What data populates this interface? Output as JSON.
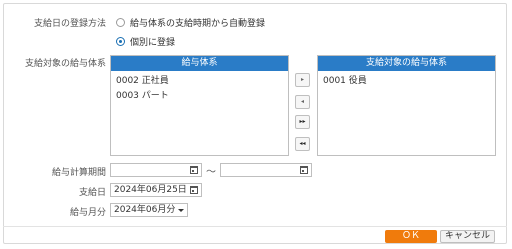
{
  "labels": {
    "registration_method": "支給日の登録方法",
    "target_salary_system": "支給対象の給与体系",
    "calc_period": "給与計算期間",
    "payment_date": "支給日",
    "salary_month": "給与月分"
  },
  "registration_options": [
    {
      "label": "給与体系の支給時期から自動登録",
      "checked": false
    },
    {
      "label": "個別に登録",
      "checked": true
    }
  ],
  "available_list": {
    "header": "給与体系",
    "items": [
      "0002 正社員",
      "0003 パート"
    ]
  },
  "selected_list": {
    "header": "支給対象の給与体系",
    "items": [
      "0001 役員"
    ]
  },
  "move_buttons": {
    "add": "▸",
    "remove": "◂",
    "add_all": "▸▸",
    "remove_all": "◂◂"
  },
  "calc_period": {
    "from": "",
    "to": "",
    "separator": "〜"
  },
  "payment_date_value": "2024年06月25日",
  "salary_month_value": "2024年06月分",
  "buttons": {
    "ok": "ＯＫ",
    "cancel": "キャンセル"
  },
  "colors": {
    "list_header": "#2a7cc7",
    "ok_button": "#f07b0c",
    "radio_accent": "#1a6fb3"
  },
  "icons": {
    "calendar": "calendar-icon",
    "dropdown": "chevron-down-icon"
  }
}
